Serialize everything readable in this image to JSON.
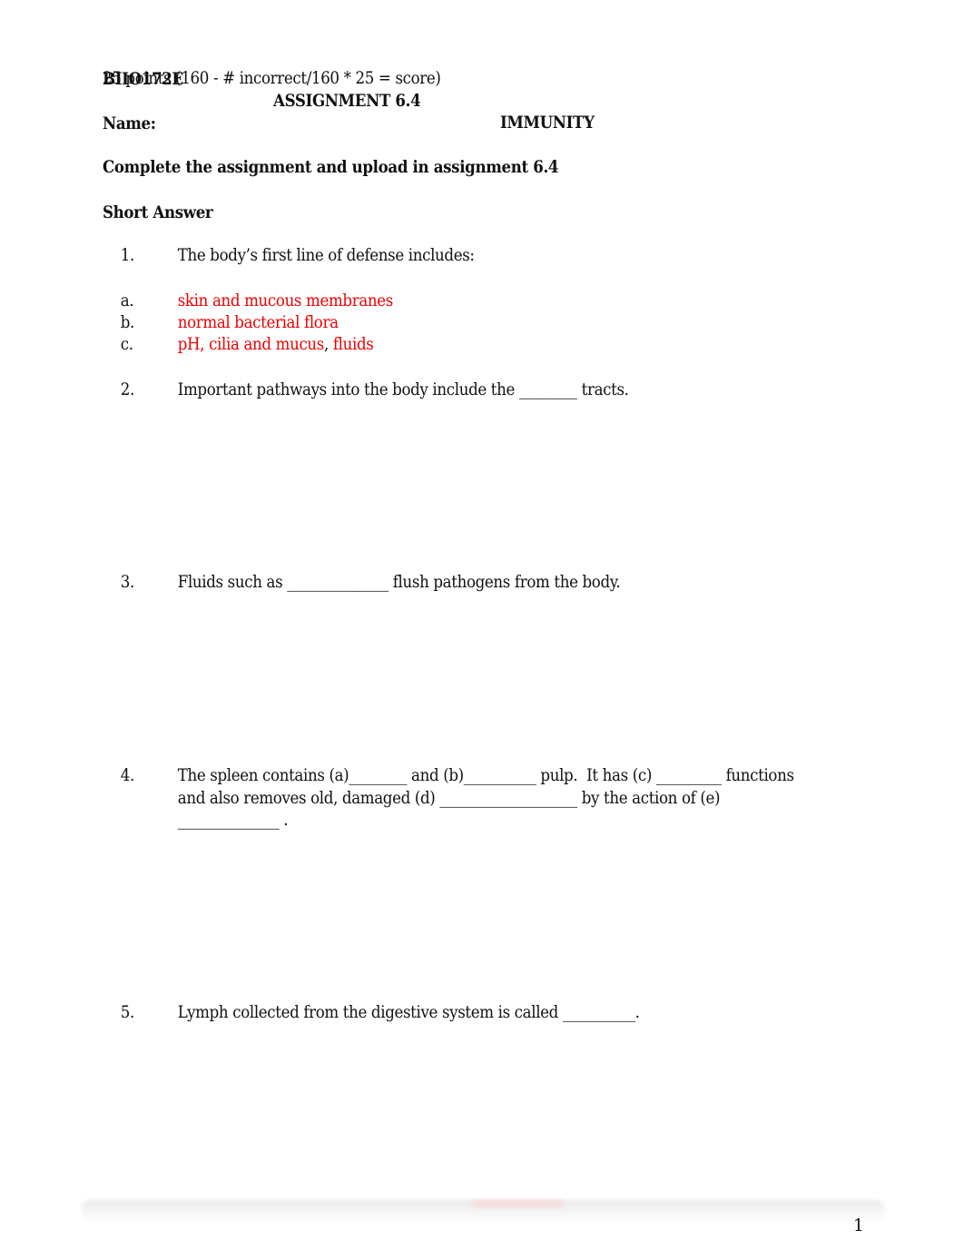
{
  "header": {
    "course_code": "BIIO172E",
    "assignment": "ASSIGNMENT 6.4",
    "topic": "IMMUNITY",
    "points_formula": "25 points (160 - # incorrect/160 * 25 = score)"
  },
  "name_label": "Name:",
  "instruction": "Complete the assignment and upload in assignment 6.4",
  "section_title": "Short Answer",
  "colors": {
    "answer": "#ee0000",
    "text": "#111111"
  },
  "questions": [
    {
      "number": "1.",
      "text": "The body’s first line of defense includes:",
      "answers": [
        {
          "letter": "a.",
          "text": "skin and mucous membranes"
        },
        {
          "letter": "b.",
          "text": "normal bacterial flora"
        },
        {
          "letter": "c.",
          "text_part1": "pH, cilia and mucus",
          "separator": ",",
          "text_part2": " fluids"
        }
      ]
    },
    {
      "number": "2.",
      "before": "Important pathways into the body include the ",
      "blank": "________",
      "after": " tracts."
    },
    {
      "number": "3.",
      "before": "Fluids such as ",
      "blank": "______________",
      "after": " flush pathogens from the body."
    },
    {
      "number": "4.",
      "line1": {
        "t1": "The spleen contains (a)",
        "blank_a": "________",
        "t2": " and (b)",
        "blank_b": "__________",
        "t3": " pulp.  It has (c) ",
        "blank_c": "_________",
        "t4": " functions"
      },
      "line2": {
        "t1": "and also removes old, damaged (d) ",
        "blank_d": "___________________",
        "t2": " by the action of (e)"
      },
      "line3": {
        "blank_e": "______________",
        "t1": " ."
      }
    },
    {
      "number": "5.",
      "before": "Lymph collected from the digestive system is called ",
      "blank": "__________",
      "after": "."
    }
  ],
  "footer": {
    "page_number": "1"
  }
}
